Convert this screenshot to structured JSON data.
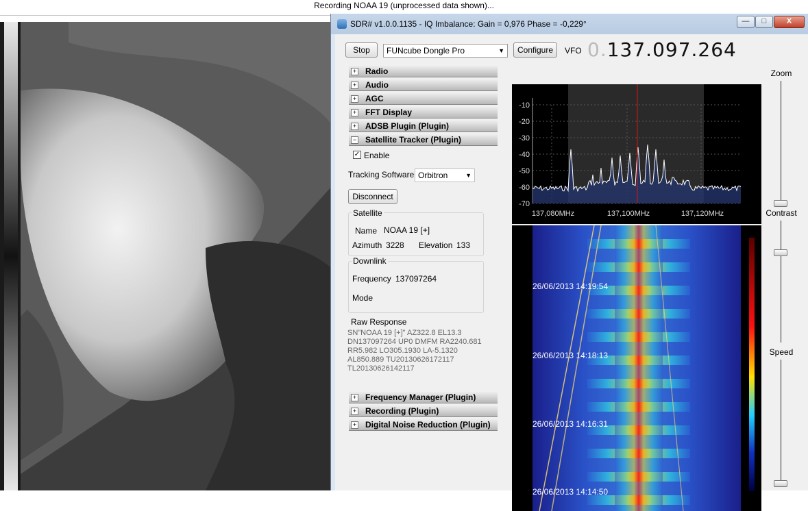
{
  "outer_title": "Recording NOAA 19 (unprocessed data shown)...",
  "window": {
    "title": "SDR# v1.0.0.1135 - IQ Imbalance: Gain = 0,976 Phase = -0,229°",
    "minimize_glyph": "—",
    "maximize_glyph": "□",
    "close_glyph": "X"
  },
  "toolbar": {
    "stop_label": "Stop",
    "device": "FUNcube Dongle Pro",
    "configure_label": "Configure",
    "vfo_label": "VFO",
    "vfo_dim": "0.",
    "vfo_value": "137.097.264"
  },
  "panels": {
    "top": [
      "Radio",
      "Audio",
      "AGC",
      "FFT Display",
      "ADSB Plugin (Plugin)",
      "Satellite Tracker (Plugin)"
    ],
    "bottom": [
      "Frequency Manager (Plugin)",
      "Recording (Plugin)",
      "Digital Noise Reduction (Plugin)"
    ],
    "expand_glyph": "+",
    "collapse_glyph": "−"
  },
  "tracker": {
    "enable_label": "Enable",
    "enable_checked": true,
    "tracking_software_label": "Tracking Software",
    "tracking_software_value": "Orbitron",
    "disconnect_label": "Disconnect",
    "satellite_group": "Satellite",
    "name_label": "Name",
    "name_value": "NOAA 19 [+]",
    "azimuth_label": "Azimuth",
    "azimuth_value": "3228",
    "elevation_label": "Elevation",
    "elevation_value": "133",
    "downlink_group": "Downlink",
    "frequency_label": "Frequency",
    "frequency_value": "137097264",
    "mode_label": "Mode",
    "raw_label": "Raw Response",
    "raw_text": "SN\"NOAA 19 [+]\" AZ322.8 EL13.3\nDN137097264 UP0 DMFM RA2240.681\nRR5.982 LO305.1930 LA-5.1320\nAL850.889 TU20130626172117\nTL20130626142117"
  },
  "spectrum": {
    "y_ticks": [
      "-10",
      "-20",
      "-30",
      "-40",
      "-50",
      "-60",
      "-70"
    ],
    "x_ticks": [
      "137,080MHz",
      "137,100MHz",
      "137,120MHz"
    ]
  },
  "waterfall": {
    "timestamps": [
      "26/06/2013 14:19:54",
      "26/06/2013 14:18:13",
      "26/06/2013 14:16:31",
      "26/06/2013 14:14:50"
    ]
  },
  "sliders": {
    "zoom_label": "Zoom",
    "contrast_label": "Contrast",
    "speed_label": "Speed",
    "zoom_level": 0.0,
    "contrast_level": 0.75,
    "speed_level": 0.0
  },
  "colors": {
    "window_frame": "#dde7f2",
    "client_bg": "#f0f0f0",
    "vfo_marker": "#e01010",
    "spectrum_line": "#ffffff",
    "spectrum_fill": "#2a3a6a"
  }
}
